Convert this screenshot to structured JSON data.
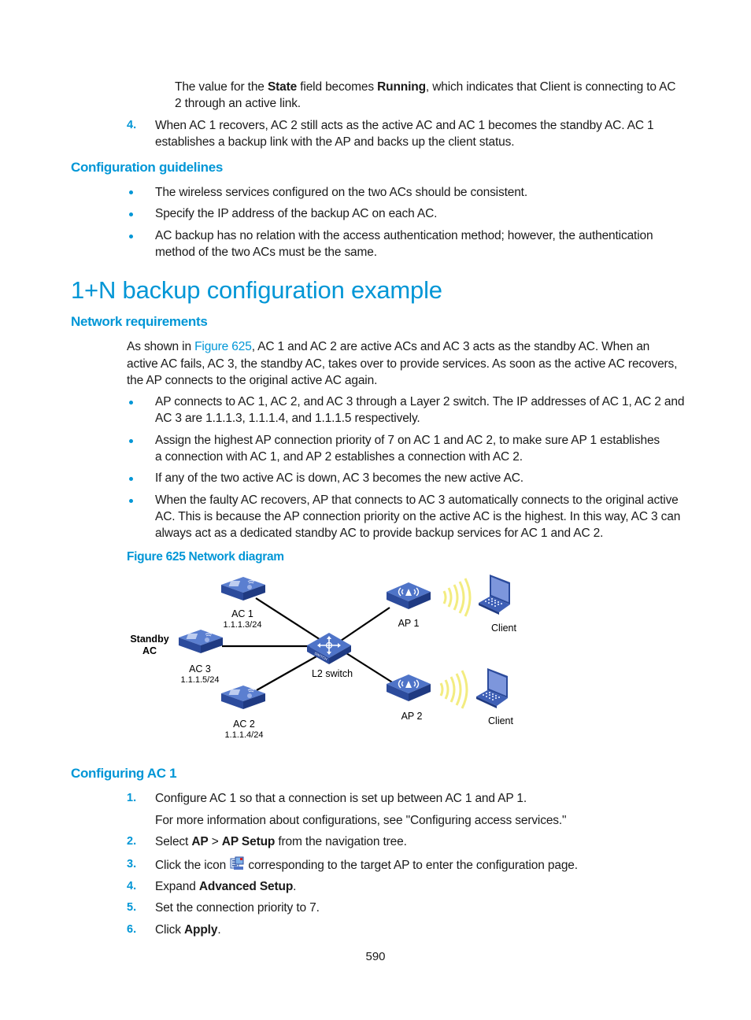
{
  "top_continuation": {
    "line1_a": "The value for the ",
    "line1_b": "State",
    "line1_c": " field becomes ",
    "line1_d": "Running",
    "line1_e": ", which indicates that Client is connecting to AC",
    "line2": "2 through an active link."
  },
  "step4": {
    "num": "4.",
    "line1": "When AC 1 recovers, AC 2 still acts as the active AC and AC 1 becomes the standby AC. AC 1",
    "line2": "establishes a backup link with the AP and backs up the client status."
  },
  "config_guidelines": {
    "heading": "Configuration guidelines",
    "items": [
      {
        "lines": [
          "The wireless services configured on the two ACs should be consistent."
        ]
      },
      {
        "lines": [
          "Specify the IP address of the backup AC on each AC."
        ]
      },
      {
        "lines": [
          "AC backup has no relation with the access authentication method; however, the authentication",
          "method of the two ACs must be the same."
        ]
      }
    ]
  },
  "section_title": "1+N backup configuration example",
  "network_requirements": {
    "heading": "Network requirements",
    "intro_a": "As shown in ",
    "intro_link": "Figure 625",
    "intro_b": ", AC 1 and AC 2 are active ACs and AC 3 acts as the standby AC. When an",
    "intro_line2": "active AC fails, AC 3, the standby AC, takes over to provide services. As soon as the active AC recovers,",
    "intro_line3": "the AP connects to the original active AC again.",
    "items": [
      {
        "lines": [
          "AP connects to AC 1, AC 2, and AC 3 through a Layer 2 switch. The IP addresses of AC 1, AC 2 and",
          "AC 3 are 1.1.1.3, 1.1.1.4, and 1.1.1.5 respectively."
        ]
      },
      {
        "lines": [
          "Assign the highest AP connection priority of 7 on AC 1 and AC 2, to make sure AP 1 establishes",
          "a connection with AC 1, and AP 2 establishes a connection with AC 2."
        ]
      },
      {
        "lines": [
          "If any of the two active AC is down, AC 3 becomes the new active AC."
        ]
      },
      {
        "lines": [
          "When the faulty AC recovers, AP that connects to AC 3 automatically connects to the original active",
          "AC. This is because the AP connection priority on the active AC is the highest. In this way, AC 3 can",
          "always act as a dedicated standby AC to provide backup services for AC 1 and AC 2."
        ]
      }
    ]
  },
  "figure": {
    "caption": "Figure 625 Network diagram",
    "nodes": {
      "ac1": {
        "name": "AC 1",
        "ip": "1.1.1.3/24"
      },
      "ac2": {
        "name": "AC 2",
        "ip": "1.1.1.4/24"
      },
      "ac3": {
        "name": "AC 3",
        "ip": "1.1.1.5/24",
        "role_line1": "Standby",
        "role_line2": "AC"
      },
      "switch": {
        "name": "L2 switch",
        "badge": "SWITCH"
      },
      "ap1": {
        "name": "AP 1"
      },
      "ap2": {
        "name": "AP 2"
      },
      "client1": {
        "name": "Client"
      },
      "client2": {
        "name": "Client"
      }
    },
    "colors": {
      "device_top": "#4a6fbf",
      "device_side": "#2a4a9a",
      "wave": "#f5ee8a",
      "link": "#000000"
    }
  },
  "configuring_ac1": {
    "heading": "Configuring AC 1",
    "steps": [
      {
        "num": "1.",
        "text": "Configure AC 1 so that a connection is set up between AC 1 and AP 1."
      },
      {
        "num": "",
        "text": "For more information about configurations, see \"Configuring access services.\""
      },
      {
        "num": "2.",
        "a": "Select ",
        "b": "AP",
        "c": " > ",
        "d": "AP Setup",
        "e": " from the navigation tree."
      },
      {
        "num": "3.",
        "a": "Click the icon ",
        "icon": "ap-config-icon",
        "e": " corresponding to the target AP to enter the configuration page."
      },
      {
        "num": "4.",
        "a": "Expand ",
        "b": "Advanced Setup",
        "e": "."
      },
      {
        "num": "5.",
        "a": "Set the connection priority to 7."
      },
      {
        "num": "6.",
        "a": "Click ",
        "b": "Apply",
        "e": "."
      }
    ]
  },
  "page_number": "590",
  "colors": {
    "accent": "#0096d6",
    "text": "#1a1a1a"
  }
}
